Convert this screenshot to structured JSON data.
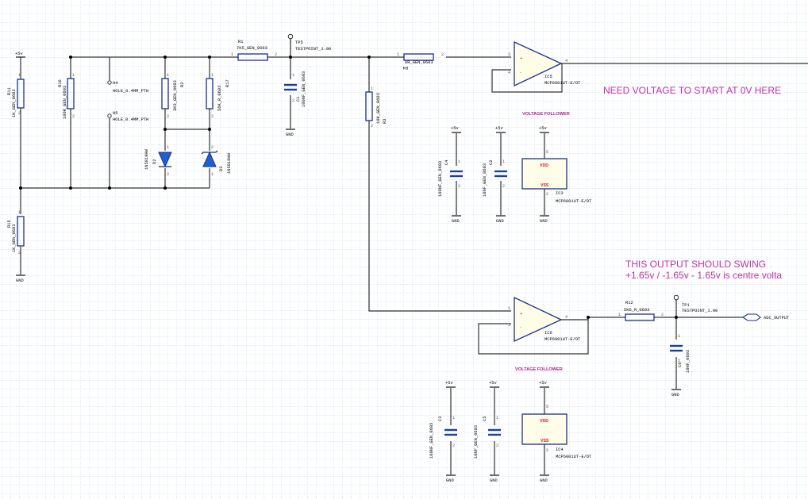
{
  "power": {
    "vcc": "+5v",
    "gnd": "GND"
  },
  "resistors": {
    "R11": {
      "ref": "R11",
      "value": "1K_GEN_0603"
    },
    "R16": {
      "ref": "R16",
      "value": "100K_GEN_0603"
    },
    "R15": {
      "ref": "R15",
      "value": "1K_GEN_0603"
    },
    "R2": {
      "ref": "R2",
      "value": "3K3_GEN_0603"
    },
    "R17": {
      "ref": "R17",
      "value": "56K_R_0603"
    },
    "R1": {
      "ref": "R1",
      "value": "7K5_GEN_0603"
    },
    "R3": {
      "ref": "R3",
      "value": "10K_GEN_0603"
    },
    "R4": {
      "ref": "R4",
      "value": "0R_GEN_0603"
    },
    "R12": {
      "ref": "R12",
      "value": "5K6_R_0603"
    }
  },
  "holes": {
    "H4": {
      "ref": "H4",
      "value": "HOLE_0.4MM_PTH"
    },
    "H5": {
      "ref": "H5",
      "value": "HOLE_0.4MM_PTH"
    }
  },
  "diodes": {
    "D2": {
      "ref": "D2",
      "value": "1N5819HW"
    },
    "D3": {
      "ref": "D3",
      "value": "1N5819HW"
    }
  },
  "capacitors": {
    "C1": {
      "ref": "C1",
      "value": "100NF_GEN_0603"
    },
    "C4": {
      "ref": "C4",
      "value": "100NF_GEN_0603"
    },
    "C2": {
      "ref": "C2",
      "value": "10NF_GEN_0603"
    },
    "C3": {
      "ref": "C3",
      "value": "100NF_GEN_0603"
    },
    "C5": {
      "ref": "C5",
      "value": "10NF_GEN_0603"
    },
    "C6": {
      "ref": "C6",
      "value": "10NF_0603"
    }
  },
  "testpoints": {
    "TP5": {
      "ref": "TP5",
      "value": "TESTPOINT_1.00"
    },
    "TP1": {
      "ref": "TP1",
      "value": "TESTPOINT_1.00"
    }
  },
  "opamps": {
    "IC5": {
      "ref": "IC5",
      "part": "MCP6001UT-E/OT"
    },
    "IC6": {
      "ref": "IC6",
      "part": "MCP6001UT-E/OT"
    },
    "IC3": {
      "ref": "IC3",
      "part": "MCP6001UT-E/OT"
    },
    "IC4": {
      "ref": "IC4",
      "part": "MCP6001UT-E/OT"
    }
  },
  "supply": {
    "vdd": "VDD",
    "vss": "VSS"
  },
  "labels": {
    "follower_top": "VOLTAGE FOLLOWER",
    "follower_bottom": "VOLTAGE FOLLOWER",
    "adc_output": "ADC_OUTPUT"
  },
  "notes": {
    "top": "NEED VOLTAGE TO START AT 0V HERE",
    "bottom_line1": "THIS OUTPUT SHOULD SWING",
    "bottom_line2": "+1.65v / -1.65v - 1.65v is centre volta"
  }
}
